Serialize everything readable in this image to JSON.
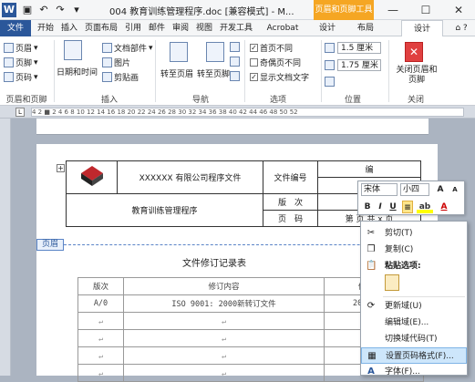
{
  "titlebar": {
    "title": "004 教育训练管理程序.doc [兼容模式] - M...",
    "context_tools": "页眉和页脚工具",
    "qa_undo": "↶",
    "qa_redo": "↷",
    "qa_customize": "▾"
  },
  "tabs": [
    "文件",
    "开始",
    "插入",
    "页面布局",
    "引用",
    "邮件",
    "审阅",
    "视图",
    "开发工具",
    "Acrobat",
    "设计",
    "布局"
  ],
  "active_tab": "设计",
  "ribbon": {
    "groups": {
      "header_footer": {
        "label": "页眉和页脚",
        "header": "页眉",
        "footer": "页脚",
        "page_number": "页码"
      },
      "insert": {
        "label": "插入",
        "date_time": "日期和时间",
        "doc_parts": "文档部件",
        "picture": "图片",
        "clip_art": "剪贴画"
      },
      "navigation": {
        "label": "导航",
        "goto_header": "转至页眉",
        "goto_footer": "转至页脚"
      },
      "options": {
        "label": "选项",
        "diff_first": "首页不同",
        "diff_odd_even": "奇偶页不同",
        "show_text": "显示文档文字"
      },
      "position": {
        "label": "位置",
        "header_top": "1.5 厘米",
        "footer_bottom": "1.75 厘米"
      },
      "close": {
        "label": "关闭",
        "button": "关闭页眉和页脚"
      }
    }
  },
  "ruler": "4 2 ■ 2 4 6 8 10 12 14 16 18 20 22 24 26 28 30 32 34 36 38 40 42 44 46 48 50 52",
  "document": {
    "company_title": "XXXXXX 有限公司程序文件",
    "doc_no_label": "文件编号",
    "doc_no_value": "编",
    "procedure_name": "教育训练管理程序",
    "version_label": "版　次",
    "page_label": "页　码",
    "page_value": "第 页 共 x 页",
    "header_tag": "页眉",
    "record_title": "文件修订记录表",
    "record_headers": [
      "版次",
      "修订内容",
      "修订日期"
    ],
    "record_rows": [
      [
        "A/0",
        "ISO 9001: 2000新转订文件",
        "2009-09-1"
      ],
      [
        "↵",
        "↵",
        "↵"
      ],
      [
        "↵",
        "↵",
        "↵"
      ],
      [
        "↵",
        "↵",
        "↵"
      ],
      [
        "↵",
        "↵",
        "↵"
      ]
    ]
  },
  "mini_toolbar": {
    "font": "宋体",
    "size": "小四",
    "grow": "A",
    "shrink": "A",
    "bold": "B",
    "italic": "I",
    "underline": "U",
    "align": "≡",
    "highlight": "ab",
    "color": "A"
  },
  "context_menu": [
    {
      "icon": "scissors-icon",
      "label": "剪切(T)"
    },
    {
      "icon": "copy-icon",
      "label": "复制(C)"
    },
    {
      "icon": "paste-icon",
      "label": "粘贴选项:"
    },
    {
      "icon": "paste-keep-icon",
      "label": ""
    },
    {
      "icon": "update-field-icon",
      "label": "更新域(U)"
    },
    {
      "icon": "",
      "label": "编辑域(E)..."
    },
    {
      "icon": "",
      "label": "切换域代码(T)"
    },
    {
      "icon": "page-number-format-icon",
      "label": "设置页码格式(F)..."
    },
    {
      "icon": "font-icon",
      "label": "字体(F)..."
    }
  ]
}
